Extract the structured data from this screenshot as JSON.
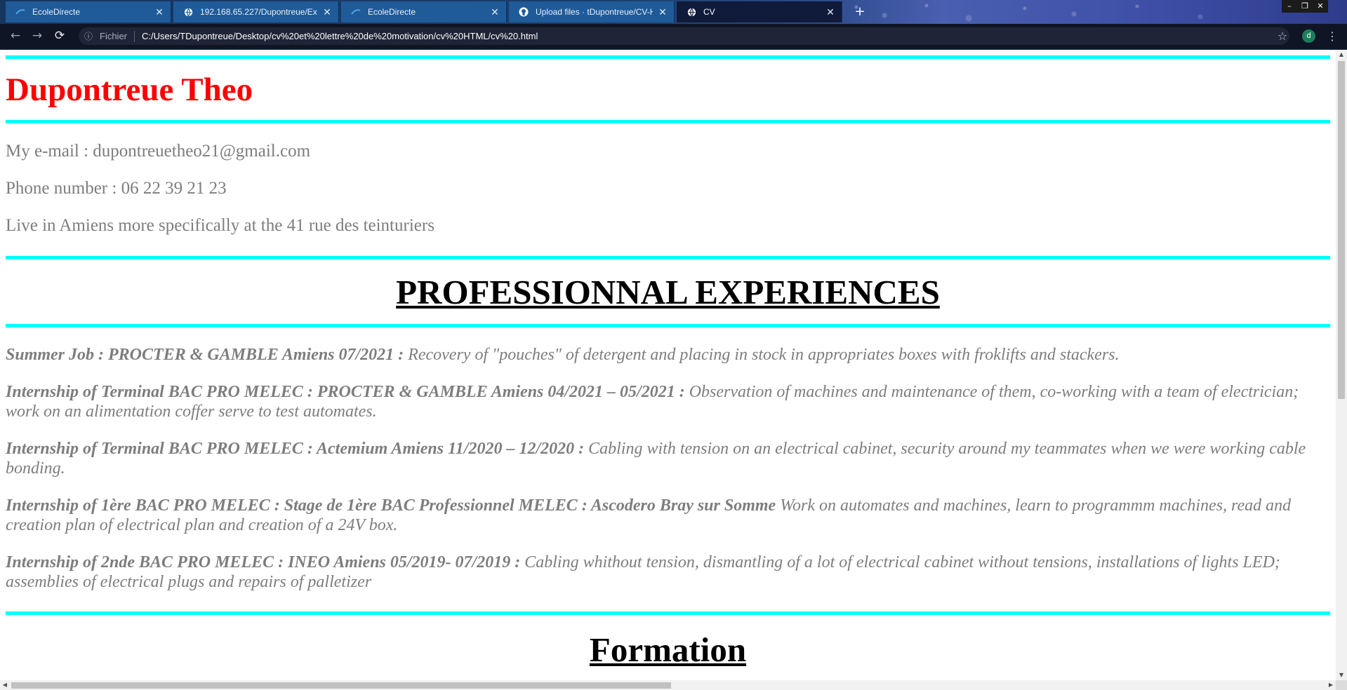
{
  "browser": {
    "tabs": [
      {
        "title": "EcoleDirecte",
        "icon": "ecoledirecte-icon",
        "active": false
      },
      {
        "title": "192.168.65.227/Dupontreue/Exer",
        "icon": "globe-icon",
        "active": false
      },
      {
        "title": "EcoleDirecte",
        "icon": "ecoledirecte-icon",
        "active": false
      },
      {
        "title": "Upload files · tDupontreue/CV-H",
        "icon": "github-icon",
        "active": false
      },
      {
        "title": "CV",
        "icon": "globe-icon",
        "active": true
      }
    ],
    "new_tab": "+",
    "address": {
      "scheme_label": "Fichier",
      "url": "C:/Users/TDupontreue/Desktop/cv%20et%20lettre%20de%20motivation/cv%20HTML/cv%20.html"
    },
    "profile_initial": "d"
  },
  "page": {
    "name": "Dupontreue Theo",
    "contact": {
      "email": "My e-mail : dupontreuetheo21@gmail.com",
      "phone": "Phone number : 06 22 39 21 23",
      "address": "Live in Amiens more specifically at the 41 rue des teinturiers"
    },
    "experience_title": "PROFESSIONNAL EXPERIENCES",
    "experiences": [
      {
        "head": "Summer Job : PROCTER & GAMBLE Amiens 07/2021 :",
        "desc": " Recovery of \"pouches\" of detergent and placing in stock in appropriates boxes with froklifts and stackers."
      },
      {
        "head": "Internship of Terminal BAC PRO MELEC : PROCTER & GAMBLE Amiens 04/2021 – 05/2021 :",
        "desc": " Observation of machines and maintenance of them, co-working with a team of electrician; work on an alimentation coffer serve to test automates."
      },
      {
        "head": "Internship of Terminal BAC PRO MELEC : Actemium Amiens 11/2020 – 12/2020 :",
        "desc": " Cabling with tension on an electrical cabinet, security around my teammates when we were working cable bonding."
      },
      {
        "head": "Internship of 1ère BAC PRO MELEC : Stage de 1ère BAC Professionnel MELEC : Ascodero Bray sur Somme",
        "desc": " Work on automates and machines, learn to programmm machines, read and creation plan of electrical plan and creation of a 24V box."
      },
      {
        "head": "Internship of 2nde BAC PRO MELEC : INEO Amiens 05/2019- 07/2019 :",
        "desc": " Cabling whithout tension, dismantling of a lot of electrical cabinet without tensions, installations of lights LED; assemblies of electrical plugs and repairs of palletizer"
      }
    ],
    "formation_title": "Formation"
  },
  "colors": {
    "accent_rule": "#00ffff",
    "name": "#ff0000",
    "body_text": "#7d7d7d"
  }
}
